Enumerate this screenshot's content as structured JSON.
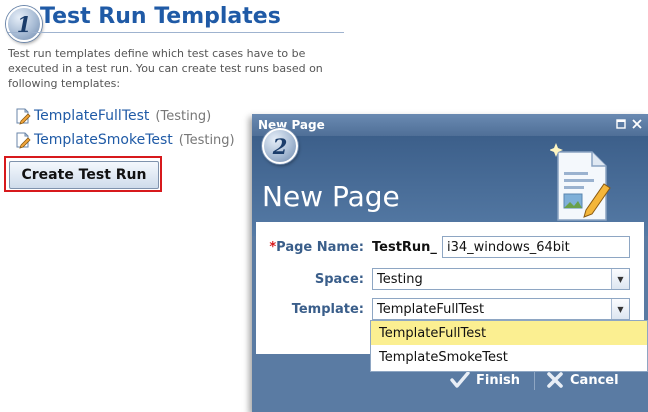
{
  "callouts": [
    "1",
    "2"
  ],
  "templates_panel": {
    "title": "Test Run Templates",
    "description": "Test run templates define which test cases have to be executed in a test run. You can create test runs based on following templates:",
    "items": [
      {
        "name": "TemplateFullTest",
        "space": "(Testing)"
      },
      {
        "name": "TemplateSmokeTest",
        "space": "(Testing)"
      }
    ],
    "create_button": "Create Test Run",
    "highlight_color": "#d7191c"
  },
  "dialog": {
    "window_title": "New Page",
    "heading": "New Page",
    "form": {
      "page_name_label": "Page Name:",
      "required_marker": "*",
      "page_name_prefix": "TestRun_",
      "page_name_value": "i34_windows_64bit",
      "space_label": "Space:",
      "space_value": "Testing",
      "template_label": "Template:",
      "template_value": "TemplateFullTest"
    },
    "template_options": [
      {
        "label": "TemplateFullTest",
        "selected": true
      },
      {
        "label": "TemplateSmokeTest",
        "selected": false
      }
    ],
    "finish_button": "Finish",
    "cancel_button": "Cancel",
    "colors": {
      "frame": "#5a7ba3",
      "label": "#3a5e8a",
      "selected_option": "#fbef91"
    }
  }
}
